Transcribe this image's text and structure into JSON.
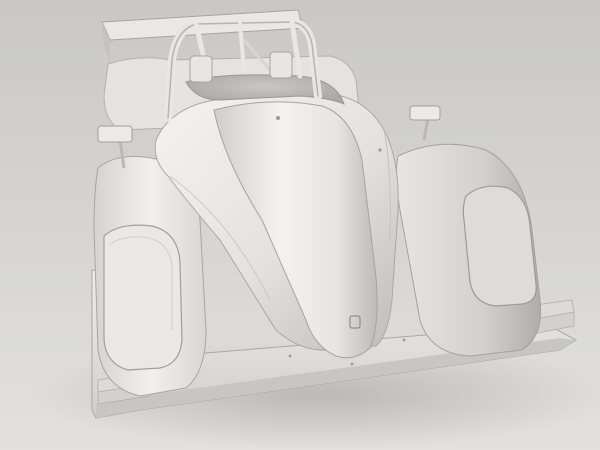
{
  "scene": {
    "subject": "untextured-racing-prototype-car-model",
    "colors": {
      "background_top": "#c9c8c6",
      "background_bottom": "#e2e1df",
      "body_light": "#f2f1ef",
      "body_mid": "#dddcda",
      "body_shadow": "#b9b8b5",
      "body_dark": "#8f8e8b",
      "floor_shadow": "#9c9b98"
    }
  }
}
